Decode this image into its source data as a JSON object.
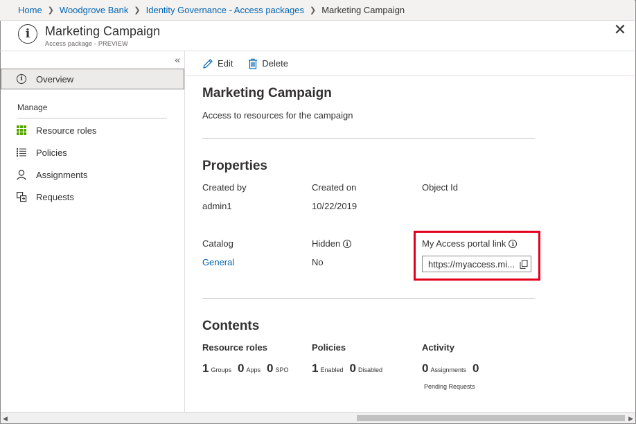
{
  "breadcrumb": {
    "items": [
      "Home",
      "Woodgrove Bank",
      "Identity Governance - Access packages"
    ],
    "current": "Marketing Campaign"
  },
  "header": {
    "title": "Marketing Campaign",
    "subtitle": "Access package - PREVIEW"
  },
  "sidebar": {
    "overview": "Overview",
    "section": "Manage",
    "items": [
      {
        "label": "Resource roles",
        "icon": "grid-icon"
      },
      {
        "label": "Policies",
        "icon": "list-icon"
      },
      {
        "label": "Assignments",
        "icon": "person-icon"
      },
      {
        "label": "Requests",
        "icon": "requests-icon"
      }
    ]
  },
  "toolbar": {
    "edit_label": "Edit",
    "delete_label": "Delete"
  },
  "main": {
    "title": "Marketing Campaign",
    "description": "Access to resources for the campaign",
    "properties_heading": "Properties",
    "created_by_label": "Created by",
    "created_by": "admin1",
    "created_on_label": "Created on",
    "created_on": "10/22/2019",
    "object_id_label": "Object Id",
    "catalog_label": "Catalog",
    "catalog": "General",
    "hidden_label": "Hidden",
    "hidden": "No",
    "portal_link_label": "My Access portal link",
    "portal_link": "https://myaccess.mi...",
    "contents_heading": "Contents",
    "resource_roles_label": "Resource roles",
    "policies_label": "Policies",
    "activity_label": "Activity",
    "groups_count": "1",
    "groups_label": "Groups",
    "apps_count": "0",
    "apps_label": "Apps",
    "spo_count": "0",
    "spo_label": "SPO",
    "enabled_count": "1",
    "enabled_label": "Enabled",
    "disabled_count": "0",
    "disabled_label": "Disabled",
    "assignments_count": "0",
    "assignments_label": "Assignments",
    "pending_count": "0",
    "pending_label": "Pending Requests"
  },
  "colors": {
    "link": "#0063b1",
    "highlight": "#e3001b",
    "grid_icon": "#57a300"
  }
}
